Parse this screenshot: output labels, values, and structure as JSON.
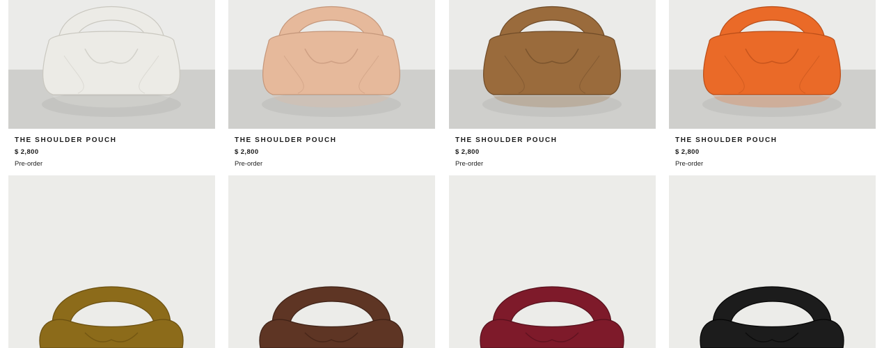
{
  "products": [
    {
      "name": "THE SHOULDER POUCH",
      "price": "$ 2,800",
      "status": "Pre-order",
      "color": "#ecebe6",
      "shade": "#c9c7bf"
    },
    {
      "name": "THE SHOULDER POUCH",
      "price": "$ 2,800",
      "status": "Pre-order",
      "color": "#e6b99b",
      "shade": "#c4967a"
    },
    {
      "name": "THE SHOULDER POUCH",
      "price": "$ 2,800",
      "status": "Pre-order",
      "color": "#9a6b3c",
      "shade": "#6e4a27"
    },
    {
      "name": "THE SHOULDER POUCH",
      "price": "$ 2,800",
      "status": "Pre-order",
      "color": "#ea6a28",
      "shade": "#b94d18"
    },
    {
      "color": "#8c6b1a",
      "shade": "#6a4f10"
    },
    {
      "color": "#5e3524",
      "shade": "#3e2116"
    },
    {
      "color": "#7e1a2a",
      "shade": "#56101c"
    },
    {
      "color": "#1c1c1c",
      "shade": "#050505"
    }
  ]
}
